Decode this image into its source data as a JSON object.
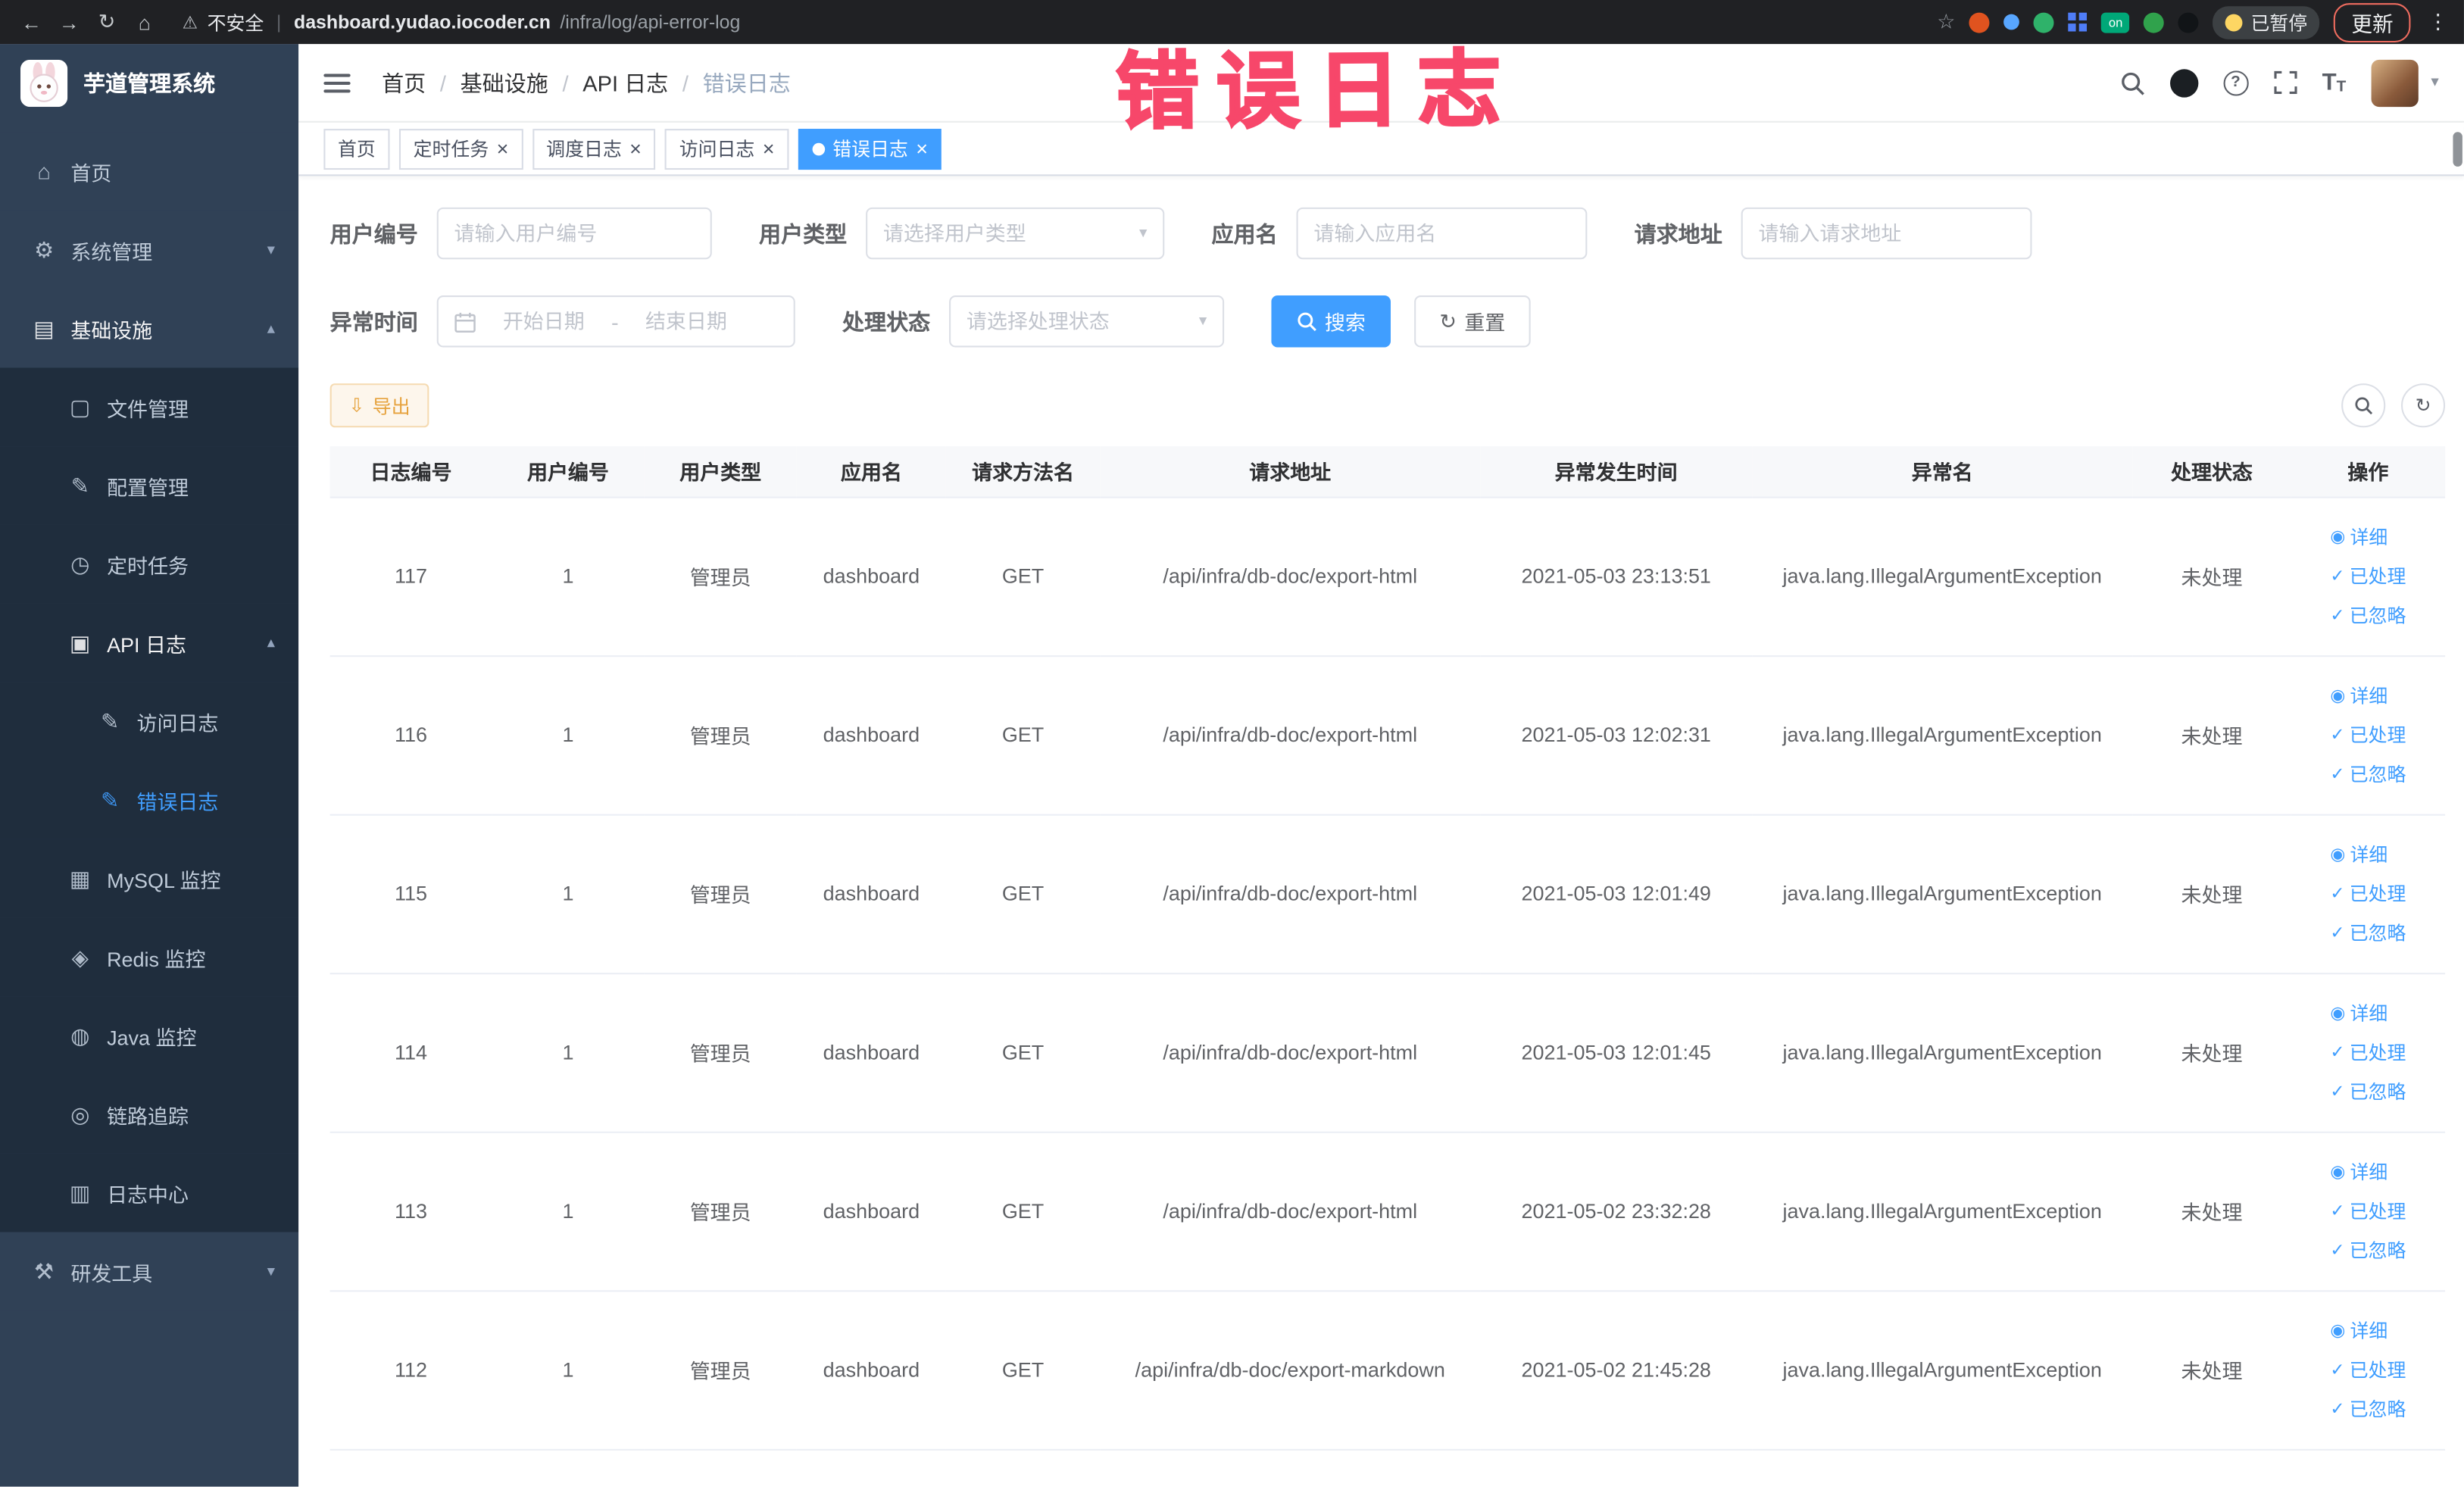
{
  "annotation": {
    "text": "错误日志"
  },
  "browser": {
    "security_label": "不安全",
    "url_domain": "dashboard.yudao.iocoder.cn",
    "url_path": "/infra/log/api-error-log",
    "extension_badge_on": "on",
    "paused_badge": "已暂停",
    "update_label": "更新"
  },
  "sidebar": {
    "logo_title": "芋道管理系统",
    "items": [
      {
        "label": "首页",
        "icon": "home-icon",
        "level": 1
      },
      {
        "label": "系统管理",
        "icon": "gear-icon",
        "level": 1,
        "chevron": "down"
      },
      {
        "label": "基础设施",
        "icon": "infrastructure-icon",
        "level": 1,
        "chevron": "up",
        "open": true
      },
      {
        "label": "文件管理",
        "icon": "file-icon",
        "level": 2
      },
      {
        "label": "配置管理",
        "icon": "config-icon",
        "level": 2
      },
      {
        "label": "定时任务",
        "icon": "timer-icon",
        "level": 2
      },
      {
        "label": "API 日志",
        "icon": "api-log-icon",
        "level": 2,
        "chevron": "up",
        "open": true
      },
      {
        "label": "访问日志",
        "icon": "access-log-icon",
        "level": 3
      },
      {
        "label": "错误日志",
        "icon": "error-log-icon",
        "level": 3,
        "active": true
      },
      {
        "label": "MySQL 监控",
        "icon": "mysql-icon",
        "level": 2
      },
      {
        "label": "Redis 监控",
        "icon": "redis-icon",
        "level": 2
      },
      {
        "label": "Java 监控",
        "icon": "java-icon",
        "level": 2
      },
      {
        "label": "链路追踪",
        "icon": "trace-icon",
        "level": 2
      },
      {
        "label": "日志中心",
        "icon": "log-center-icon",
        "level": 2
      },
      {
        "label": "研发工具",
        "icon": "devtools-icon",
        "level": 1,
        "chevron": "down"
      }
    ]
  },
  "header": {
    "breadcrumb": [
      "首页",
      "基础设施",
      "API 日志",
      "错误日志"
    ]
  },
  "tabs": [
    {
      "label": "首页",
      "closable": false,
      "active": false
    },
    {
      "label": "定时任务",
      "closable": true,
      "active": false
    },
    {
      "label": "调度日志",
      "closable": true,
      "active": false
    },
    {
      "label": "访问日志",
      "closable": true,
      "active": false
    },
    {
      "label": "错误日志",
      "closable": true,
      "active": true
    }
  ],
  "filters": {
    "user_id_label": "用户编号",
    "user_id_placeholder": "请输入用户编号",
    "user_type_label": "用户类型",
    "user_type_placeholder": "请选择用户类型",
    "app_name_label": "应用名",
    "app_name_placeholder": "请输入应用名",
    "request_url_label": "请求地址",
    "request_url_placeholder": "请输入请求地址",
    "exception_time_label": "异常时间",
    "date_start_placeholder": "开始日期",
    "date_separator": "-",
    "date_end_placeholder": "结束日期",
    "process_status_label": "处理状态",
    "process_status_placeholder": "请选择处理状态",
    "search_label": "搜索",
    "reset_label": "重置"
  },
  "toolbar": {
    "export_label": "导出"
  },
  "table": {
    "columns": [
      "日志编号",
      "用户编号",
      "用户类型",
      "应用名",
      "请求方法名",
      "请求地址",
      "异常发生时间",
      "异常名",
      "处理状态",
      "操作"
    ],
    "action_labels": [
      "详细",
      "已处理",
      "已忽略"
    ],
    "rows": [
      {
        "id": "117",
        "user_id": "1",
        "user_type": "管理员",
        "app": "dashboard",
        "method": "GET",
        "url": "/api/infra/db-doc/export-html",
        "time": "2021-05-03 23:13:51",
        "exception": "java.lang.IllegalArgumentException",
        "status": "未处理"
      },
      {
        "id": "116",
        "user_id": "1",
        "user_type": "管理员",
        "app": "dashboard",
        "method": "GET",
        "url": "/api/infra/db-doc/export-html",
        "time": "2021-05-03 12:02:31",
        "exception": "java.lang.IllegalArgumentException",
        "status": "未处理"
      },
      {
        "id": "115",
        "user_id": "1",
        "user_type": "管理员",
        "app": "dashboard",
        "method": "GET",
        "url": "/api/infra/db-doc/export-html",
        "time": "2021-05-03 12:01:49",
        "exception": "java.lang.IllegalArgumentException",
        "status": "未处理"
      },
      {
        "id": "114",
        "user_id": "1",
        "user_type": "管理员",
        "app": "dashboard",
        "method": "GET",
        "url": "/api/infra/db-doc/export-html",
        "time": "2021-05-03 12:01:45",
        "exception": "java.lang.IllegalArgumentException",
        "status": "未处理"
      },
      {
        "id": "113",
        "user_id": "1",
        "user_type": "管理员",
        "app": "dashboard",
        "method": "GET",
        "url": "/api/infra/db-doc/export-html",
        "time": "2021-05-02 23:32:28",
        "exception": "java.lang.IllegalArgumentException",
        "status": "未处理"
      },
      {
        "id": "112",
        "user_id": "1",
        "user_type": "管理员",
        "app": "dashboard",
        "method": "GET",
        "url": "/api/infra/db-doc/export-markdown",
        "time": "2021-05-02 21:45:28",
        "exception": "java.lang.IllegalArgumentException",
        "status": "未处理"
      }
    ]
  },
  "colors": {
    "accent": "#409EFF",
    "sidebar_bg": "#304156",
    "submenu_bg": "#1f2d3d",
    "active_text": "#409EFF",
    "warning_text": "#e6a23c",
    "annotation": "#f7476a"
  }
}
